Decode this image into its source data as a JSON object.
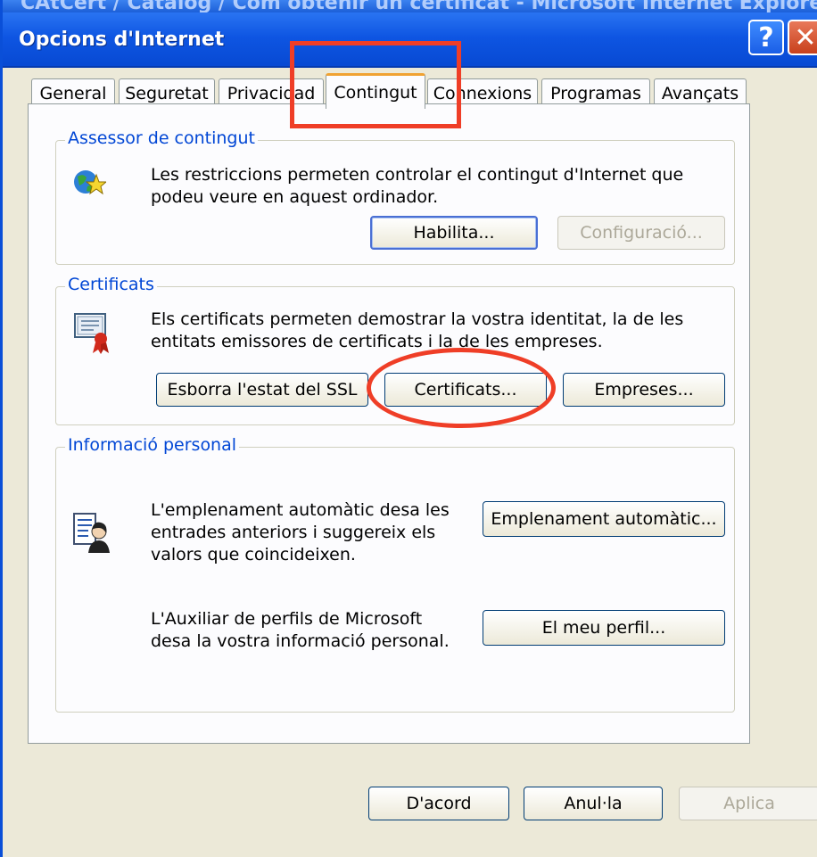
{
  "window": {
    "behind_title": "CAtCert / Catalog / Com obtenir un certificat - Microsoft Internet Explorer",
    "title": "Opcions d'Internet",
    "help_label": "?",
    "close_label": "✕"
  },
  "tabs": [
    {
      "label": "General"
    },
    {
      "label": "Seguretat"
    },
    {
      "label": "Privacidad"
    },
    {
      "label": "Contingut",
      "active": true
    },
    {
      "label": "Connexions"
    },
    {
      "label": "Programas"
    },
    {
      "label": "Avançats"
    }
  ],
  "content_advisor": {
    "group_label": "Assessor de contingut",
    "description_line1": "Les restriccions permeten controlar el contingut d'Internet que",
    "description_line2": "podeu veure en aquest ordinador.",
    "enable_label": "Habilita...",
    "settings_label": "Configuració..."
  },
  "certificates": {
    "group_label": "Certificats",
    "description_line1": "Els certificats permeten demostrar la vostra identitat, la de les",
    "description_line2": "entitats emissores de certificats i la de les empreses.",
    "clear_ssl_label": "Esborra l'estat del SSL",
    "certificates_label": "Certificats...",
    "publishers_label": "Empreses..."
  },
  "personal_info": {
    "group_label": "Informació personal",
    "autocomplete_line1": "L'emplenament automàtic desa les",
    "autocomplete_line2": "entrades anteriors i suggereix els",
    "autocomplete_line3": "valors que coincideixen.",
    "autocomplete_button": "Emplenament automàtic...",
    "profile_line1": "L'Auxiliar de perfils de Microsoft",
    "profile_line2": "desa la vostra informació personal.",
    "profile_button": "El meu perfil..."
  },
  "footer": {
    "ok_label": "D'acord",
    "cancel_label": "Anul·la",
    "apply_label": "Aplica"
  },
  "colors": {
    "annotation": "#ef3e27",
    "titlebar": "#0e55e2",
    "group_label": "#0046d5",
    "dialog_bg": "#ece9d8"
  }
}
